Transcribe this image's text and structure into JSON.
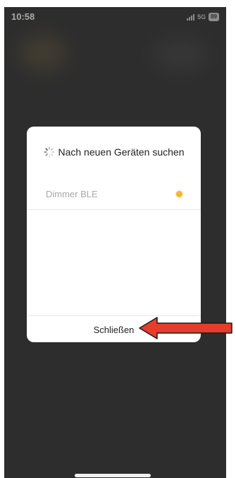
{
  "status_bar": {
    "time": "10:58",
    "network": "5G",
    "battery": "89"
  },
  "dialog": {
    "title": "Nach neuen Geräten suchen",
    "spinner_icon": "loading-spinner-icon",
    "devices": [
      {
        "name": "Dimmer BLE",
        "status_color": "#f5b731"
      }
    ],
    "close_label": "Schließen"
  },
  "annotation": {
    "arrow_color": "#e53c2b",
    "arrow_direction": "left",
    "points_to": "close-button"
  },
  "colors": {
    "background": "#2d2d2d",
    "dialog": "#ffffff",
    "accent_dot": "#f5b731"
  }
}
